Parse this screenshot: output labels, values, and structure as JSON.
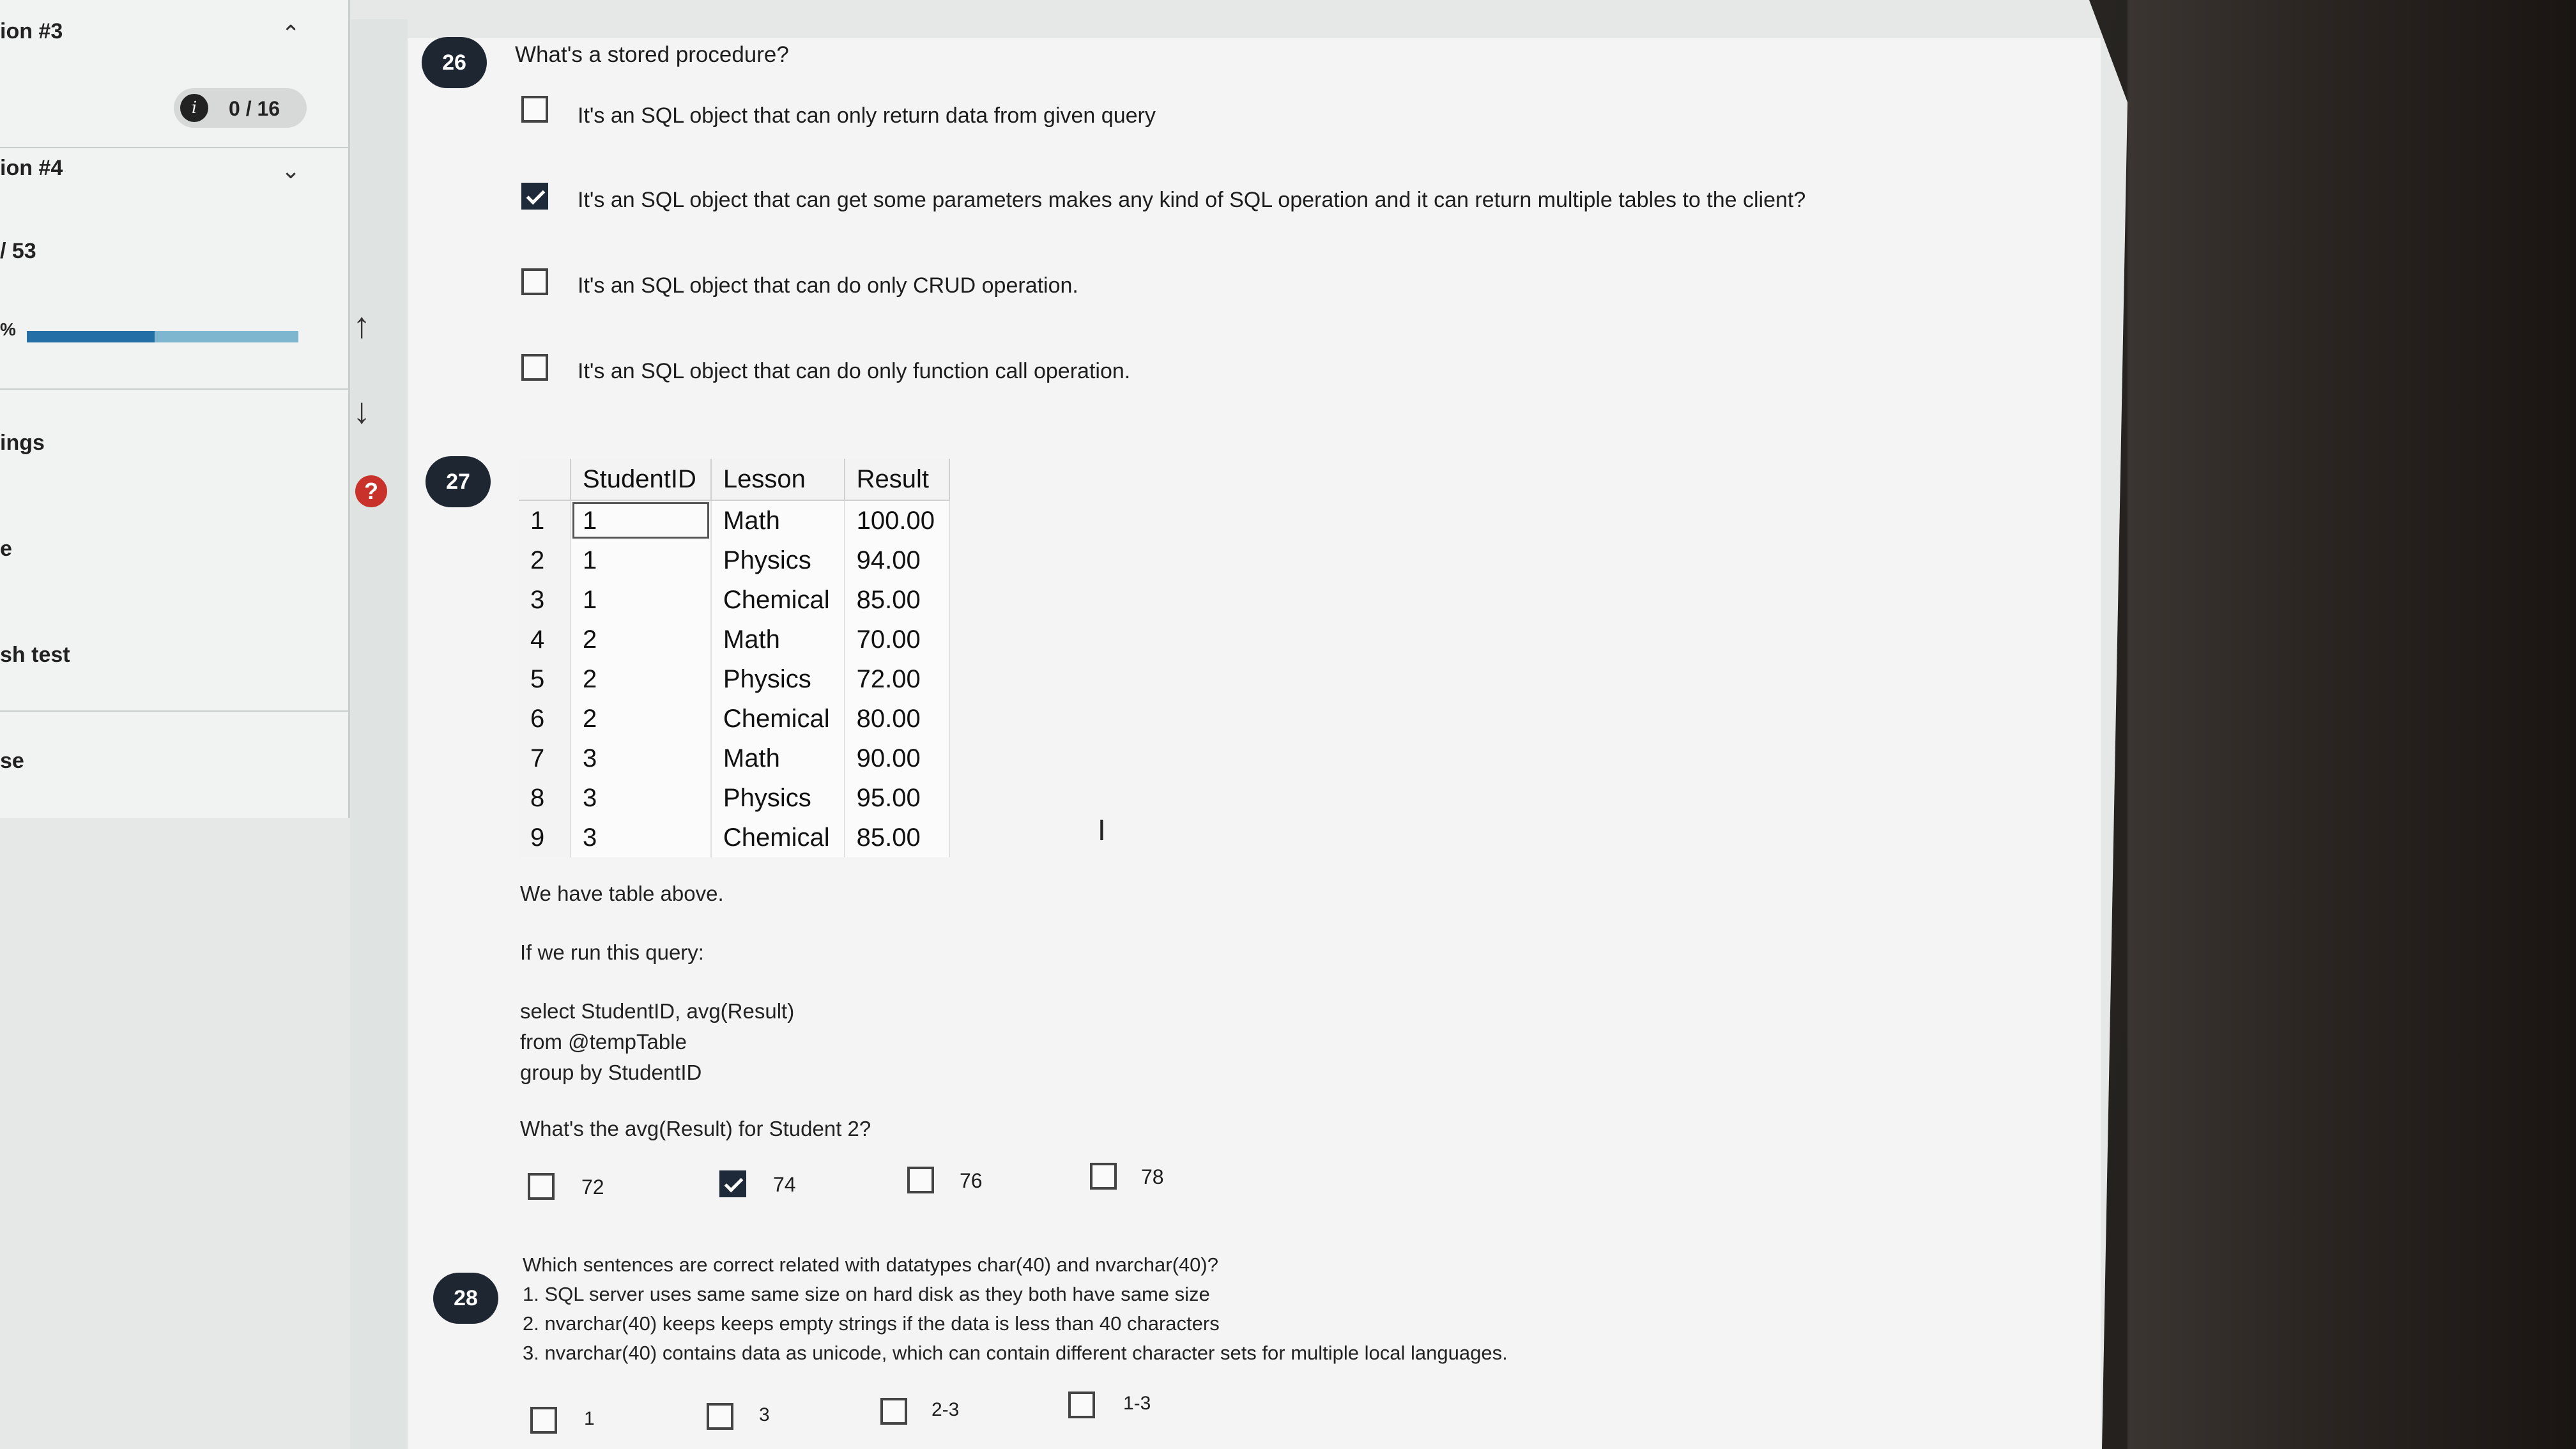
{
  "sidebar": {
    "section3_label": "ion #3",
    "score": "0 / 16",
    "section4_label": "ion #4",
    "count": "/ 53",
    "progress_label": "%",
    "progress_value": 0.47,
    "item_settings": "ings",
    "item_e": "e",
    "item_test": "sh test",
    "item_se": "se"
  },
  "nav": {
    "help_symbol": "?"
  },
  "q26": {
    "number": "26",
    "question": "What's a stored procedure?",
    "options": [
      {
        "label": "It's an SQL object that can only return data from given query",
        "checked": false
      },
      {
        "label": "It's an SQL object that can get some parameters makes any kind of SQL operation and it can return multiple tables to the client?",
        "checked": true
      },
      {
        "label": "It's an SQL object that can do only CRUD operation.",
        "checked": false
      },
      {
        "label": "It's an SQL object that can do only function call operation.",
        "checked": false
      }
    ]
  },
  "q27": {
    "number": "27",
    "table": {
      "headers": [
        "StudentID",
        "Lesson",
        "Result"
      ],
      "rows": [
        [
          "1",
          "1",
          "Math",
          "100.00"
        ],
        [
          "2",
          "1",
          "Physics",
          "94.00"
        ],
        [
          "3",
          "1",
          "Chemical",
          "85.00"
        ],
        [
          "4",
          "2",
          "Math",
          "70.00"
        ],
        [
          "5",
          "2",
          "Physics",
          "72.00"
        ],
        [
          "6",
          "2",
          "Chemical",
          "80.00"
        ],
        [
          "7",
          "3",
          "Math",
          "90.00"
        ],
        [
          "8",
          "3",
          "Physics",
          "95.00"
        ],
        [
          "9",
          "3",
          "Chemical",
          "85.00"
        ]
      ]
    },
    "line1": "We have table above.",
    "line2": "If we run this query:",
    "query1": "select StudentID, avg(Result)",
    "query2": "from @tempTable",
    "query3": "group by StudentID",
    "question": "What's the avg(Result) for Student 2?",
    "options": [
      {
        "label": "72",
        "checked": false
      },
      {
        "label": "74",
        "checked": true
      },
      {
        "label": "76",
        "checked": false
      },
      {
        "label": "78",
        "checked": false
      }
    ]
  },
  "q28": {
    "number": "28",
    "question": "Which sentences are correct related with datatypes char(40) and nvarchar(40)?",
    "s1": "1. SQL server uses same same size on hard disk as they both have same size",
    "s2": "2. nvarchar(40) keeps keeps empty strings if the data is less than 40 characters",
    "s3": "3. nvarchar(40) contains data as unicode, which can contain different character sets for multiple local languages.",
    "options": [
      {
        "label": "1",
        "checked": false
      },
      {
        "label": "3",
        "checked": false
      },
      {
        "label": "2-3",
        "checked": false
      },
      {
        "label": "1-3",
        "checked": false
      }
    ]
  }
}
